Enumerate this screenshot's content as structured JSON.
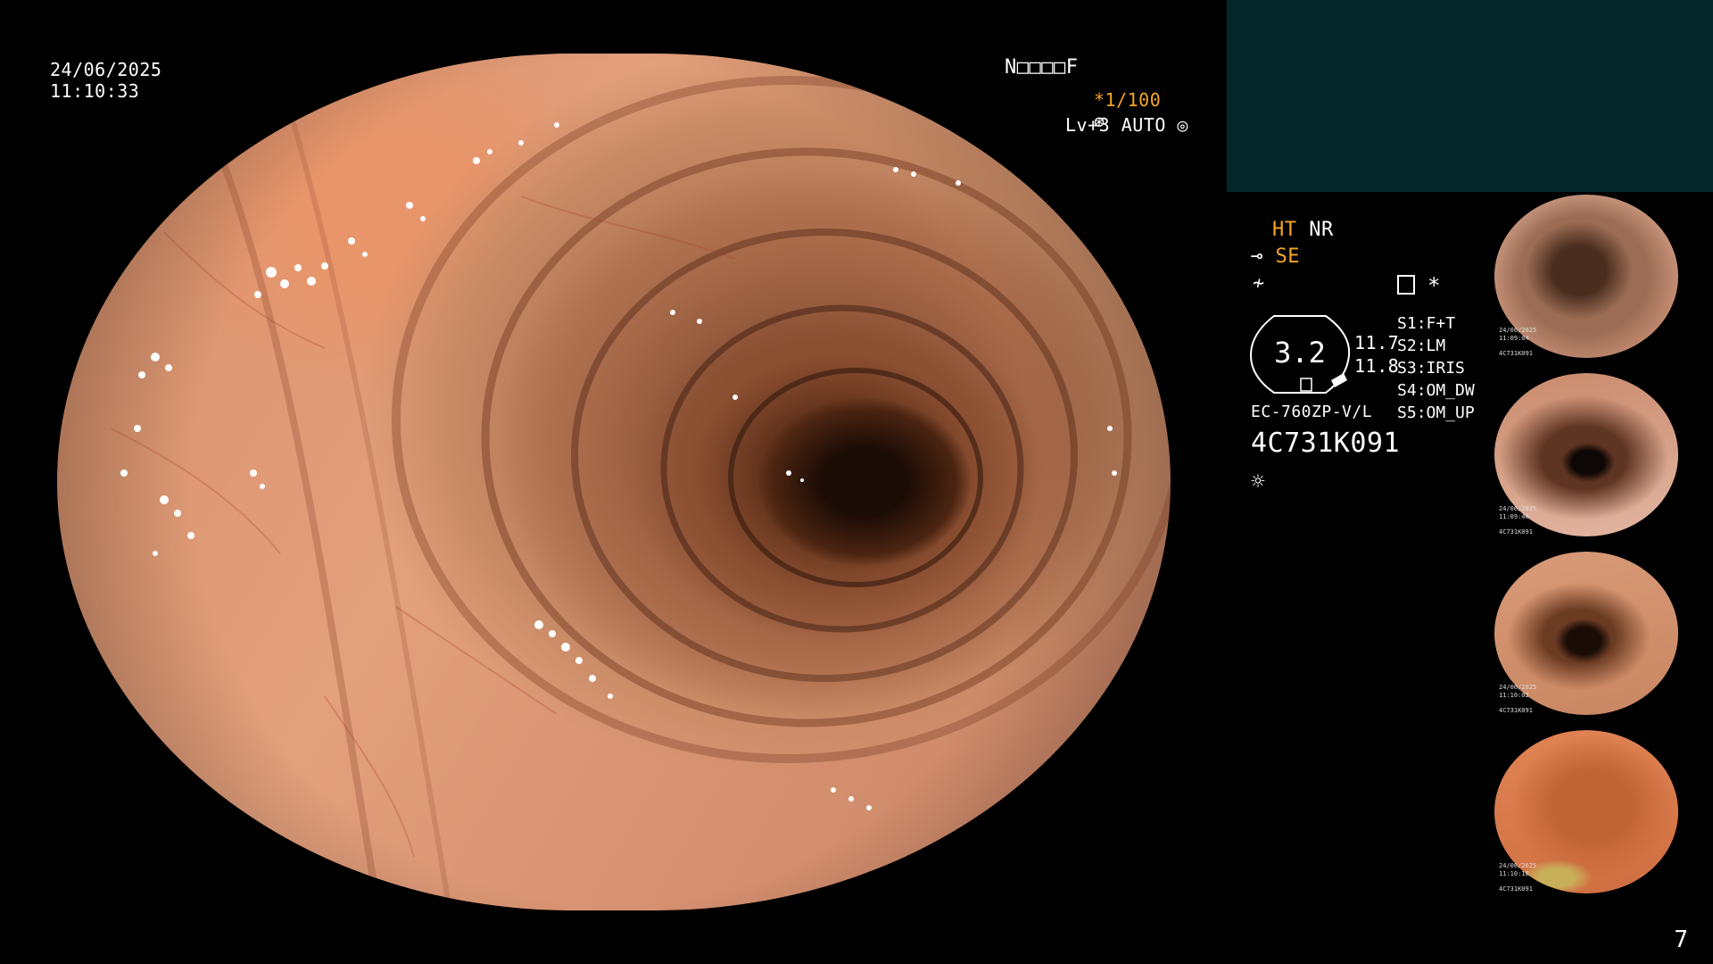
{
  "overlay": {
    "date": "24/06/2025",
    "time": "11:10:33",
    "patient_id": "N□□□□F",
    "shutter": "*1/100",
    "level": "Lv+3 AUTO"
  },
  "settings": {
    "ht": "HT",
    "nr": "NR",
    "se": "SE",
    "zoom_value": "3.2",
    "reading_top": "11.7",
    "reading_bottom": "11.8",
    "scope_model": "EC-760ZP-V/L",
    "serial": "4C731K091",
    "switches": [
      {
        "key": "S1",
        "value": "F+T"
      },
      {
        "key": "S2",
        "value": "LM"
      },
      {
        "key": "S3",
        "value": "IRIS"
      },
      {
        "key": "S4",
        "value": "OM_DW"
      },
      {
        "key": "S5",
        "value": "OM_UP"
      }
    ],
    "asterisk": "*"
  },
  "thumbnails": [
    {
      "date": "24/06/2025",
      "time": "11:09:04",
      "id": "4C731K091"
    },
    {
      "date": "24/06/2025",
      "time": "11:09:40",
      "id": "4C731K091"
    },
    {
      "date": "24/06/2025",
      "time": "11:10:02",
      "id": "4C731K091"
    },
    {
      "date": "24/06/2025",
      "time": "11:10:18",
      "id": "4C731K091"
    }
  ],
  "page_number": "7",
  "colors": {
    "accent": "#f5a623",
    "panel": "#052628",
    "background": "#000000"
  },
  "icons": [
    "shutter-icon",
    "auto-level-icon",
    "scope-icon",
    "wave-icon",
    "memory-icon",
    "light-icon"
  ]
}
